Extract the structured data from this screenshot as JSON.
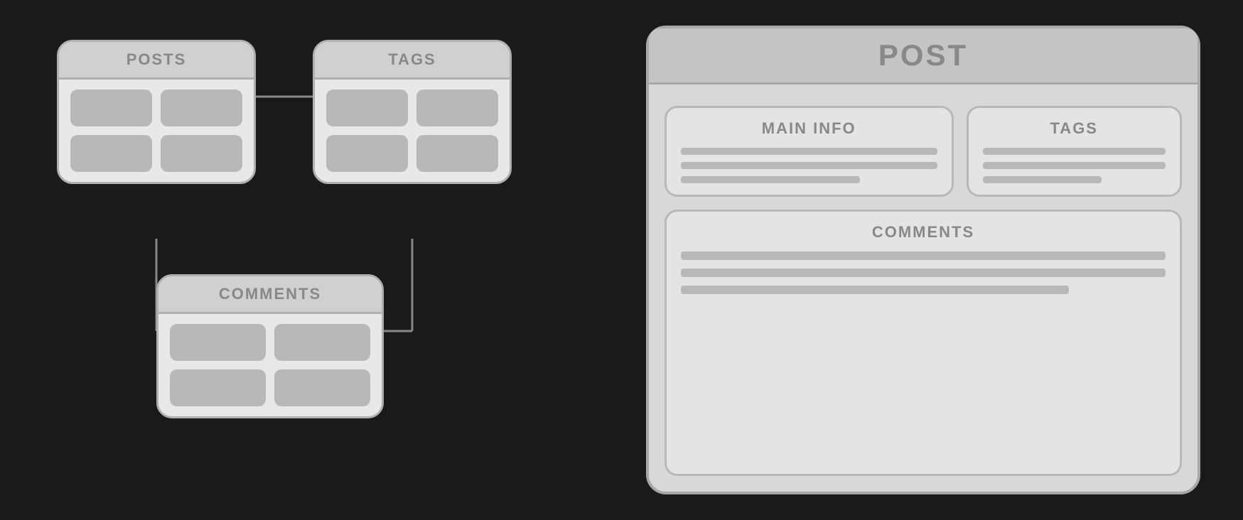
{
  "diagram": {
    "posts": {
      "title": "POSTS",
      "cells": 4
    },
    "tags": {
      "title": "TAGS",
      "cells": 4
    },
    "comments": {
      "title": "COMMENTS",
      "cells": 4
    }
  },
  "post_panel": {
    "title": "POST",
    "main_info": {
      "label": "MAIN INFO",
      "lines": 3
    },
    "tags": {
      "label": "TAGS",
      "lines": 3
    },
    "comments": {
      "label": "COMMENTS",
      "lines": 3
    }
  },
  "colors": {
    "background": "#1a1a1a",
    "card_bg": "#e8e8e8",
    "card_border": "#b0b0b0",
    "header_bg": "#d0d0d0",
    "cell_bg": "#b8b8b8",
    "text_color": "#888888",
    "panel_bg": "#d8d8d8",
    "line_color": "#b8b8b8"
  }
}
